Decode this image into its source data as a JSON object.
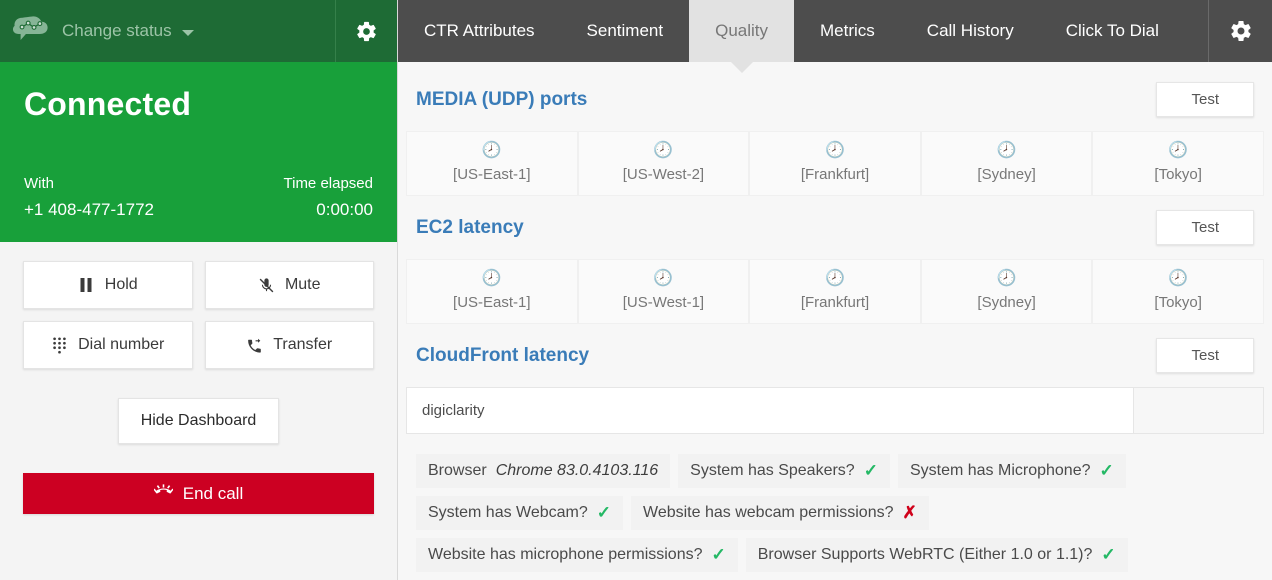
{
  "ccp": {
    "logo_icon": "cloud-network-logo",
    "change_status_label": "Change status",
    "chevron_icon": "chevron-down-icon",
    "settings_icon": "gear-icon",
    "status_title": "Connected",
    "with_label": "With",
    "time_elapsed_label": "Time elapsed",
    "phone_number": "+1 408-477-1772",
    "time_elapsed_value": "0:00:00",
    "controls": [
      {
        "label": "Hold",
        "icon": "pause-icon"
      },
      {
        "label": "Mute",
        "icon": "microphone-muted-icon"
      },
      {
        "label": "Dial number",
        "icon": "dialpad-icon"
      },
      {
        "label": "Transfer",
        "icon": "call-transfer-icon"
      }
    ],
    "hide_dashboard_label": "Hide Dashboard",
    "end_call_label": "End call",
    "end_call_icon": "end-call-icon",
    "colors": {
      "topbar_green": "#1e6b35",
      "status_green": "#18a03a",
      "end_call_red": "#cc0022"
    }
  },
  "dashboard": {
    "tabs": [
      {
        "label": "CTR Attributes",
        "active": false
      },
      {
        "label": "Sentiment",
        "active": false
      },
      {
        "label": "Quality",
        "active": true
      },
      {
        "label": "Metrics",
        "active": false
      },
      {
        "label": "Call History",
        "active": false
      },
      {
        "label": "Click To Dial",
        "active": false
      }
    ],
    "settings_icon": "gear-icon",
    "sections": [
      {
        "title": "MEDIA (UDP) ports",
        "test_label": "Test",
        "regions": [
          {
            "label": "[US-East-1]",
            "status_icon": "clock-icon"
          },
          {
            "label": "[US-West-2]",
            "status_icon": "clock-icon"
          },
          {
            "label": "[Frankfurt]",
            "status_icon": "clock-icon"
          },
          {
            "label": "[Sydney]",
            "status_icon": "clock-icon"
          },
          {
            "label": "[Tokyo]",
            "status_icon": "clock-icon"
          }
        ]
      },
      {
        "title": "EC2 latency",
        "test_label": "Test",
        "regions": [
          {
            "label": "[US-East-1]",
            "status_icon": "clock-icon"
          },
          {
            "label": "[US-West-1]",
            "status_icon": "clock-icon"
          },
          {
            "label": "[Frankfurt]",
            "status_icon": "clock-icon"
          },
          {
            "label": "[Sydney]",
            "status_icon": "clock-icon"
          },
          {
            "label": "[Tokyo]",
            "status_icon": "clock-icon"
          }
        ]
      }
    ],
    "cloudfront": {
      "title": "CloudFront latency",
      "test_label": "Test",
      "input_value": "digiclarity",
      "input_placeholder": ""
    },
    "checks": [
      {
        "label": "Browser",
        "value": "Chrome 83.0.4103.116",
        "result": ""
      },
      {
        "label": "System has Speakers?",
        "value": "",
        "result": "pass"
      },
      {
        "label": "System has Microphone?",
        "value": "",
        "result": "pass"
      },
      {
        "label": "System has Webcam?",
        "value": "",
        "result": "pass"
      },
      {
        "label": "Website has webcam permissions?",
        "value": "",
        "result": "fail"
      },
      {
        "label": "Website has microphone permissions?",
        "value": "",
        "result": "pass"
      },
      {
        "label": "Browser Supports WebRTC (Either 1.0 or 1.1)?",
        "value": "",
        "result": "pass"
      }
    ],
    "colors": {
      "tabbar_gray": "#4d4d4d",
      "active_tab": "#e2e2e2",
      "section_title_blue": "#3a7cb8",
      "pending_amber": "#f0b429",
      "pass_green": "#24b865",
      "fail_red": "#d0021b"
    }
  }
}
